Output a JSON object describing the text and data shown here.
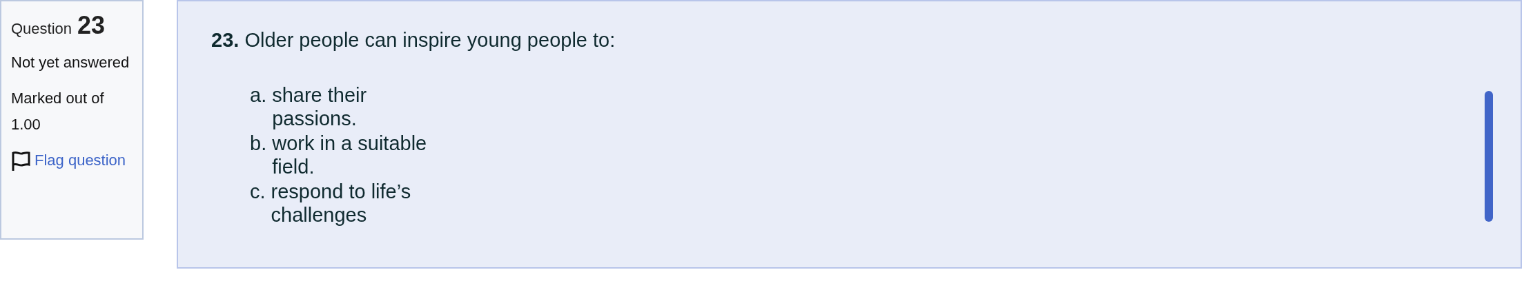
{
  "info": {
    "label": "Question",
    "number": "23",
    "status": "Not yet answered",
    "marks": "Marked out of 1.00",
    "flag": {
      "label": "Flag question",
      "flagged": false
    }
  },
  "question": {
    "number": "23.",
    "text": "Older people can inspire young people to:",
    "options": [
      {
        "letter": "a.",
        "text": "share their passions.",
        "selected": false
      },
      {
        "letter": "b.",
        "text": "work in a suitable field.",
        "selected": false
      },
      {
        "letter": "c.",
        "text": "respond to life’s challenges",
        "selected": false
      }
    ]
  }
}
